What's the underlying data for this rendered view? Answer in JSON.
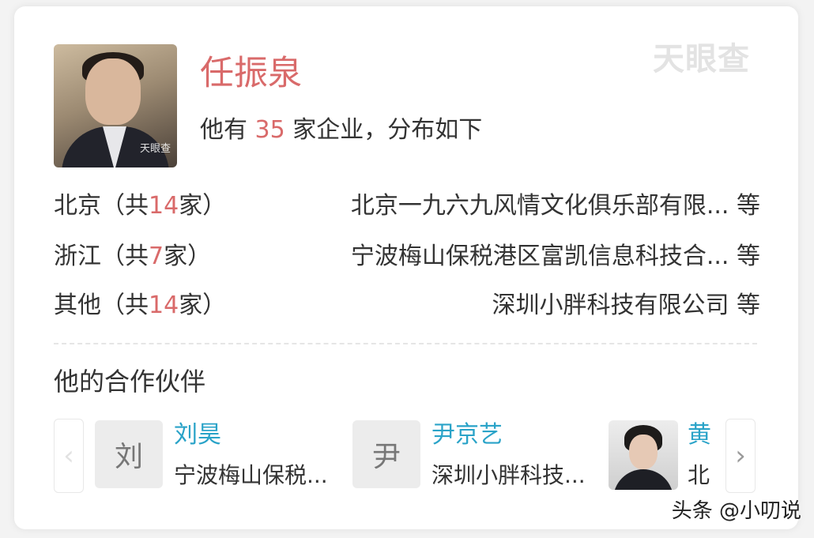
{
  "watermark": "天眼查",
  "profile": {
    "name": "任振泉",
    "photo_watermark": "天眼查",
    "summary_prefix": "他有",
    "company_count": "35",
    "summary_suffix": "家企业，分布如下"
  },
  "regions": [
    {
      "region": "北京",
      "prefix": "（共",
      "count": "14",
      "suffix": "家）",
      "company": "北京一九六九风情文化俱乐部有限...",
      "more": "等"
    },
    {
      "region": "浙江",
      "prefix": "（共",
      "count": "7",
      "suffix": "家）",
      "company": "宁波梅山保税港区富凯信息科技合...",
      "more": "等"
    },
    {
      "region": "其他",
      "prefix": "（共",
      "count": "14",
      "suffix": "家）",
      "company": "深圳小胖科技有限公司",
      "more": "等"
    }
  ],
  "partners_title": "他的合作伙伴",
  "partners": [
    {
      "avatar_text": "刘",
      "name": "刘昊",
      "company": "宁波梅山保税..."
    },
    {
      "avatar_text": "尹",
      "name": "尹京艺",
      "company": "深圳小胖科技..."
    },
    {
      "avatar_text": "",
      "name": "黄",
      "company": "北"
    }
  ],
  "nav": {
    "prev_icon": "‹",
    "next_icon": "›"
  },
  "footer": "头条 @小叨说",
  "colors": {
    "accent_red": "#d96a6a",
    "partner_name_blue": "#2aa3c8"
  },
  "icons": {
    "prev": "chevron-left-icon",
    "next": "chevron-right-icon"
  }
}
